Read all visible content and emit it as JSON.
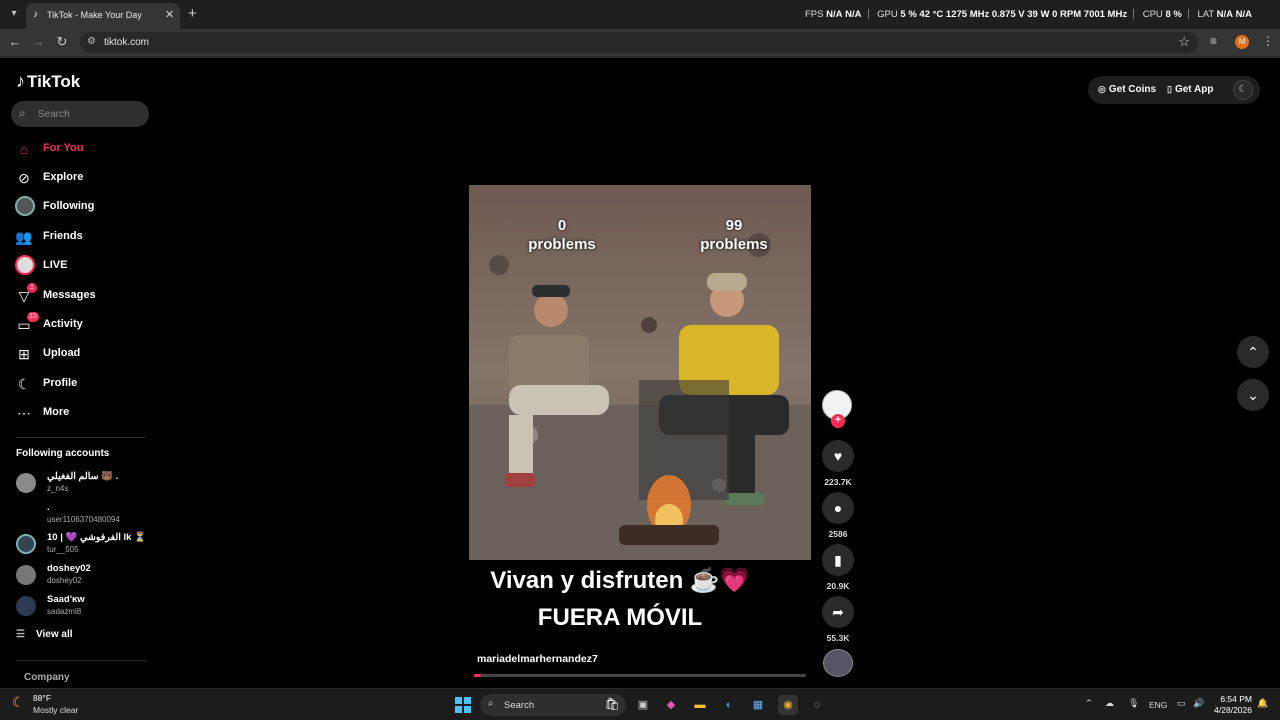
{
  "browser": {
    "tab_title": "TikTok - Make Your Day",
    "url": "tiktok.com",
    "profile_initial": "M",
    "perf": {
      "fps_label": "FPS",
      "fps_val1": "N/A",
      "fps_val2": "N/A",
      "gpu_label": "GPU",
      "gpu_pct": "5 %",
      "gpu_temp": "42 °C",
      "gpu_mhz": "1275 MHz",
      "gpu_v": "0.875 V",
      "gpu_w": "39 W",
      "gpu_rpm": "0 RPM",
      "gpu_mem": "7001 MHz",
      "cpu_label": "CPU",
      "cpu_pct": "8 %",
      "lat_label": "LAT",
      "lat_val1": "N/A",
      "lat_val2": "N/A"
    }
  },
  "tiktok": {
    "logo": "TikTok",
    "search_placeholder": "Search",
    "nav": [
      {
        "label": "For You",
        "icon": "home-icon"
      },
      {
        "label": "Explore",
        "icon": "compass-icon"
      },
      {
        "label": "Following",
        "icon": "following-avatar"
      },
      {
        "label": "Friends",
        "icon": "friends-icon"
      },
      {
        "label": "LIVE",
        "icon": "live-avatar"
      },
      {
        "label": "Messages",
        "icon": "messages-icon",
        "badge": "1"
      },
      {
        "label": "Activity",
        "icon": "activity-icon",
        "badge": "10"
      },
      {
        "label": "Upload",
        "icon": "upload-icon"
      },
      {
        "label": "Profile",
        "icon": "profile-icon"
      },
      {
        "label": "More",
        "icon": "more-icon"
      }
    ],
    "following_title": "Following accounts",
    "accounts": [
      {
        "name": "سالم الفغيلي 🐻 .",
        "user": "z_n4s"
      },
      {
        "name": ".",
        "user": "user1106370480094"
      },
      {
        "name": "10 | 💜 الفرفوشي lk ⏳",
        "user": "tur__505"
      },
      {
        "name": "doshey02",
        "user": "doshey02"
      },
      {
        "name": "Saad'ĸw",
        "user": "sadazml8"
      }
    ],
    "view_all": "View all",
    "company": "Company",
    "get_coins": "Get Coins",
    "get_app": "Get App"
  },
  "video": {
    "left_label_num": "0",
    "left_label_text": "problems",
    "right_label_num": "99",
    "right_label_text": "problems",
    "caption_line1": "Vivan y disfruten ☕💗",
    "caption_line2": "FUERA MÓVIL",
    "author": "mariadelmarhernandez7",
    "progress": 0.02,
    "likes": "223.7K",
    "comments": "2586",
    "saves": "20.9K",
    "shares": "55.3K"
  },
  "taskbar": {
    "weather_temp": "88°F",
    "weather_desc": "Mostly clear",
    "search_placeholder": "Search",
    "lang": "ENG",
    "time": "6:54 PM",
    "date": "4/28/2026"
  }
}
